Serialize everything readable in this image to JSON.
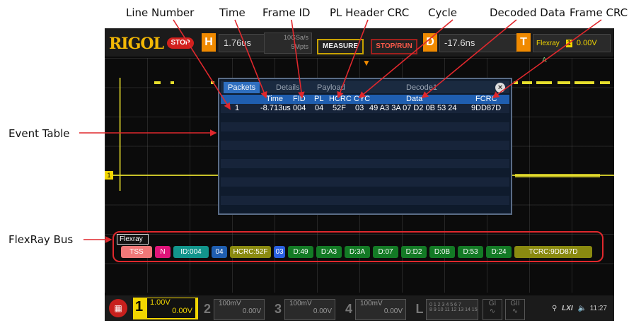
{
  "callouts": {
    "line_number": "Line Number",
    "time": "Time",
    "frame_id": "Frame ID",
    "pl_header_crc": "PL Header CRC",
    "cycle": "Cycle",
    "decoded_data": "Decoded Data",
    "frame_crc": "Frame CRC",
    "event_table": "Event Table",
    "flexray_bus": "FlexRay Bus"
  },
  "topbar": {
    "logo": "RIGOL",
    "run_state": "STOP",
    "h_label": "H",
    "h_value": "1.76us",
    "sample_rate": "10GSa/s",
    "mem_depth": "5Mpts",
    "measure_label": "MEASURE",
    "stoprun_label": "STOP/RUN",
    "d_label": "D",
    "d_value": "-17.6ns",
    "t_label": "T",
    "trigger_source": "Flexray",
    "trigger_channel": "1",
    "trigger_level": "0.00V",
    "trigger_mode": "A"
  },
  "event_table": {
    "tabs": [
      "Packets",
      "Details",
      "Payload",
      "Decode1"
    ],
    "active_tab": 0,
    "close_label": "×",
    "headers": {
      "time": "Time",
      "fid": "FID",
      "pl": "PL",
      "hcrc": "HCRC",
      "cyc": "CYC",
      "data": "Data",
      "fcrc": "FCRC"
    },
    "rows": [
      {
        "line": "1",
        "time": "-8.713us",
        "fid": "004",
        "pl": "04",
        "hcrc": "52F",
        "cyc": "03",
        "data": "49 A3 3A 07 D2 0B 53 24",
        "fcrc": "9DD87D"
      }
    ]
  },
  "bus": {
    "label": "Flexray",
    "segments": [
      {
        "text": "TSS",
        "color": "#f07878"
      },
      {
        "text": "N",
        "color": "#e0157a"
      },
      {
        "text": "ID:004",
        "color": "#12958c"
      },
      {
        "text": "04",
        "color": "#1f5eb0"
      },
      {
        "text": "HCRC:52F",
        "color": "#8a8a10"
      },
      {
        "text": "03",
        "color": "#2a60e0"
      },
      {
        "text": "D:49",
        "color": "#137a25"
      },
      {
        "text": "D:A3",
        "color": "#137a25"
      },
      {
        "text": "D:3A",
        "color": "#137a25"
      },
      {
        "text": "D:07",
        "color": "#137a25"
      },
      {
        "text": "D:D2",
        "color": "#137a25"
      },
      {
        "text": "D:0B",
        "color": "#137a25"
      },
      {
        "text": "D:53",
        "color": "#137a25"
      },
      {
        "text": "D:24",
        "color": "#137a25"
      },
      {
        "text": "TCRC:9DD87D",
        "color": "#8a8a10"
      }
    ]
  },
  "channels": [
    {
      "num": "1",
      "scale": "1.00V",
      "offset": "0.00V",
      "active": true
    },
    {
      "num": "2",
      "scale": "100mV",
      "offset": "0.00V",
      "active": false
    },
    {
      "num": "3",
      "scale": "100mV",
      "offset": "0.00V",
      "active": false
    },
    {
      "num": "4",
      "scale": "100mV",
      "offset": "0.00V",
      "active": false
    }
  ],
  "logic": {
    "label": "L",
    "bits_row1": "0 1 2 3  4 5 6 7",
    "bits_row2": "8 9 10 11 12 13 14 15"
  },
  "generators": [
    "GI",
    "GII"
  ],
  "status": {
    "lxi": "LXI",
    "time": "11:27"
  },
  "colors": {
    "trace": "#e6de2c",
    "callout_arrow": "#e0282d",
    "accent_orange": "#f08a00"
  }
}
